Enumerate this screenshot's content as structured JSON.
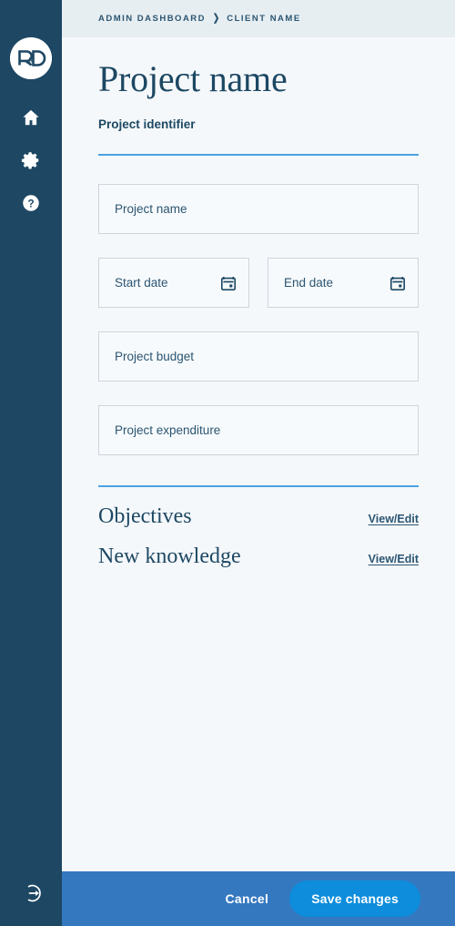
{
  "sidebar": {
    "logo": {
      "name": "rd-logo",
      "text": "R&D"
    },
    "items": [
      {
        "name": "home-icon",
        "label": "Home"
      },
      {
        "name": "settings-gear-icon",
        "label": "Settings"
      },
      {
        "name": "help-question-icon",
        "label": "Help"
      }
    ],
    "logout": {
      "name": "logout-icon",
      "label": "Log out"
    },
    "background_color": "#1d4763"
  },
  "breadcrumb": {
    "items": [
      "ADMIN DASHBOARD",
      "CLIENT NAME"
    ],
    "separator": "❯",
    "background_color": "#e7eef1"
  },
  "page": {
    "title": "Project name",
    "subtitle": "Project identifier",
    "divider_color": "#4aa3e2"
  },
  "form": {
    "fields": [
      {
        "name": "project-name-input",
        "label": "Project name",
        "value": "",
        "placeholder": "Project name",
        "icon": null
      },
      {
        "name": "start-date-input",
        "label": "Start date",
        "value": "",
        "placeholder": "Start date",
        "icon": "calendar-icon"
      },
      {
        "name": "end-date-input",
        "label": "End date",
        "value": "",
        "placeholder": "End date",
        "icon": "calendar-icon"
      },
      {
        "name": "project-budget-input",
        "label": "Project budget",
        "value": "",
        "placeholder": "Project budget",
        "icon": null
      },
      {
        "name": "project-expenditure-input",
        "label": "Project expenditure",
        "value": "",
        "placeholder": "Project expenditure",
        "icon": null
      }
    ]
  },
  "sections": [
    {
      "title": "Objectives",
      "link_label": "View/Edit"
    },
    {
      "title": "New knowledge",
      "link_label": "View/Edit"
    }
  ],
  "footer": {
    "cancel_label": "Cancel",
    "save_label": "Save changes",
    "background_color": "#3478c0",
    "save_color": "#0d8ddb"
  }
}
